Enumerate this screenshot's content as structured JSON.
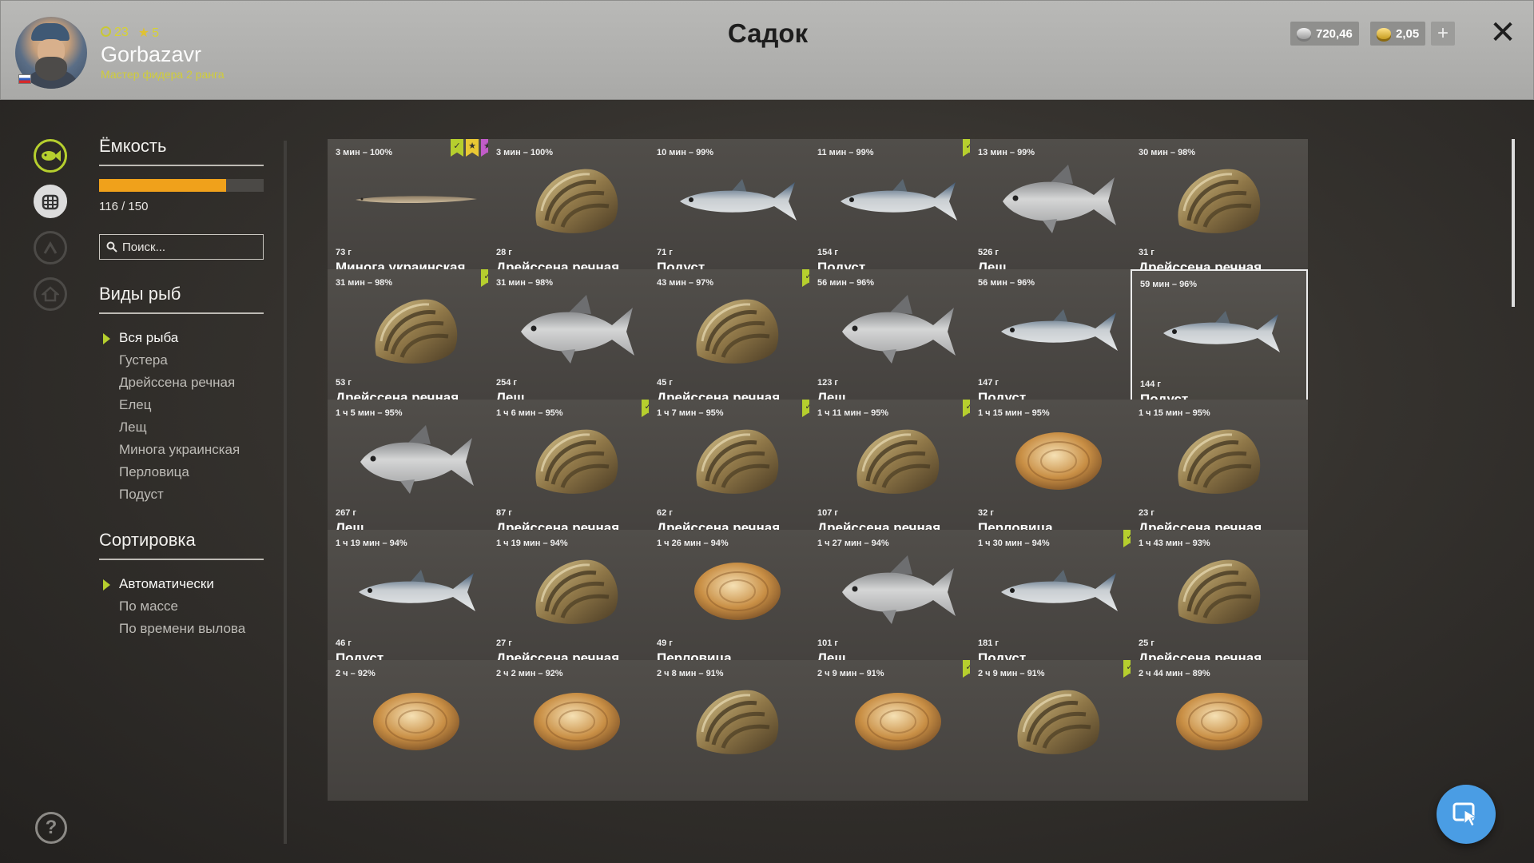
{
  "header": {
    "title": "Садок",
    "player": {
      "level": "23",
      "stars": "5",
      "username": "Gorbazavr",
      "rank": "Мастер фидера 2 ранга"
    },
    "silver": "720,46",
    "gold": "2,05",
    "plus_label": "+",
    "close_label": "✕"
  },
  "capacity": {
    "heading": "Ёмкость",
    "current": 116,
    "max": 150,
    "label": "116 / 150"
  },
  "search": {
    "placeholder": "Поиск..."
  },
  "species": {
    "heading": "Виды рыб",
    "items": [
      "Вся рыба",
      "Густера",
      "Дрейссена речная",
      "Елец",
      "Лещ",
      "Минога украинская",
      "Перловица",
      "Подуст"
    ],
    "selected": 0
  },
  "sorting": {
    "heading": "Сортировка",
    "items": [
      "Автоматически",
      "По массе",
      "По времени вылова"
    ],
    "selected": 0
  },
  "help_label": "?",
  "catches": [
    {
      "time": "3 мин – 100%",
      "weight": "73 г",
      "name": "Минога украинская",
      "kind": "lamprey",
      "marks": [
        "green",
        "yellow",
        "purple"
      ]
    },
    {
      "time": "3 мин – 100%",
      "weight": "28 г",
      "name": "Дрейссена речная",
      "kind": "mussel",
      "marks": []
    },
    {
      "time": "10 мин – 99%",
      "weight": "71 г",
      "name": "Подуст",
      "kind": "slim",
      "marks": []
    },
    {
      "time": "11 мин – 99%",
      "weight": "154 г",
      "name": "Подуст",
      "kind": "slim",
      "marks": [
        "green"
      ]
    },
    {
      "time": "13 мин – 99%",
      "weight": "526 г",
      "name": "Лещ",
      "kind": "bream",
      "marks": []
    },
    {
      "time": "30 мин – 98%",
      "weight": "31 г",
      "name": "Дрейссена речная",
      "kind": "mussel",
      "marks": []
    },
    {
      "time": "31 мин – 98%",
      "weight": "53 г",
      "name": "Дрейссена речная",
      "kind": "mussel",
      "marks": [
        "green"
      ]
    },
    {
      "time": "31 мин – 98%",
      "weight": "254 г",
      "name": "Лещ",
      "kind": "bream",
      "marks": []
    },
    {
      "time": "43 мин – 97%",
      "weight": "45 г",
      "name": "Дрейссена речная",
      "kind": "mussel",
      "marks": [
        "green"
      ]
    },
    {
      "time": "56 мин – 96%",
      "weight": "123 г",
      "name": "Лещ",
      "kind": "bream",
      "marks": []
    },
    {
      "time": "56 мин – 96%",
      "weight": "147 г",
      "name": "Подуст",
      "kind": "slim",
      "marks": []
    },
    {
      "time": "59 мин – 96%",
      "weight": "144 г",
      "name": "Подуст",
      "kind": "slim",
      "marks": [],
      "active": true
    },
    {
      "time": "1 ч 5 мин – 95%",
      "weight": "267 г",
      "name": "Лещ",
      "kind": "bream",
      "marks": []
    },
    {
      "time": "1 ч 6 мин – 95%",
      "weight": "87 г",
      "name": "Дрейссена речная",
      "kind": "mussel",
      "marks": [
        "green"
      ]
    },
    {
      "time": "1 ч 7 мин – 95%",
      "weight": "62 г",
      "name": "Дрейссена речная",
      "kind": "mussel",
      "marks": [
        "green"
      ]
    },
    {
      "time": "1 ч 11 мин – 95%",
      "weight": "107 г",
      "name": "Дрейссена речная",
      "kind": "mussel",
      "marks": [
        "green"
      ]
    },
    {
      "time": "1 ч 15 мин – 95%",
      "weight": "32 г",
      "name": "Перловица",
      "kind": "clam",
      "marks": []
    },
    {
      "time": "1 ч 15 мин – 95%",
      "weight": "23 г",
      "name": "Дрейссена речная",
      "kind": "mussel",
      "marks": []
    },
    {
      "time": "1 ч 19 мин – 94%",
      "weight": "46 г",
      "name": "Подуст",
      "kind": "slim",
      "marks": []
    },
    {
      "time": "1 ч 19 мин – 94%",
      "weight": "27 г",
      "name": "Дрейссена речная",
      "kind": "mussel",
      "marks": []
    },
    {
      "time": "1 ч 26 мин – 94%",
      "weight": "49 г",
      "name": "Перловица",
      "kind": "clam",
      "marks": []
    },
    {
      "time": "1 ч 27 мин – 94%",
      "weight": "101 г",
      "name": "Лещ",
      "kind": "bream",
      "marks": []
    },
    {
      "time": "1 ч 30 мин – 94%",
      "weight": "181 г",
      "name": "Подуст",
      "kind": "slim",
      "marks": [
        "green"
      ]
    },
    {
      "time": "1 ч 43 мин – 93%",
      "weight": "25 г",
      "name": "Дрейссена речная",
      "kind": "mussel",
      "marks": []
    },
    {
      "time": "2 ч – 92%",
      "weight": "",
      "name": "",
      "kind": "clam",
      "marks": []
    },
    {
      "time": "2 ч 2 мин – 92%",
      "weight": "",
      "name": "",
      "kind": "clam",
      "marks": []
    },
    {
      "time": "2 ч 8 мин – 91%",
      "weight": "",
      "name": "",
      "kind": "mussel",
      "marks": []
    },
    {
      "time": "2 ч 9 мин – 91%",
      "weight": "",
      "name": "",
      "kind": "clam",
      "marks": [
        "green"
      ]
    },
    {
      "time": "2 ч 9 мин – 91%",
      "weight": "",
      "name": "",
      "kind": "mussel",
      "marks": [
        "green"
      ]
    },
    {
      "time": "2 ч 44 мин – 89%",
      "weight": "",
      "name": "",
      "kind": "clam",
      "marks": []
    }
  ],
  "colors": {
    "accent_green": "#b6cf2e",
    "capacity_orange": "#f0a11b",
    "mark_yellow": "#e9c834",
    "mark_purple": "#c15cc8",
    "fab_blue": "#4a9de4"
  },
  "icons": {
    "nav": [
      "fish-icon",
      "keepnet-icon",
      "rank-icon",
      "home-icon"
    ],
    "fab": "cursor-icon"
  }
}
